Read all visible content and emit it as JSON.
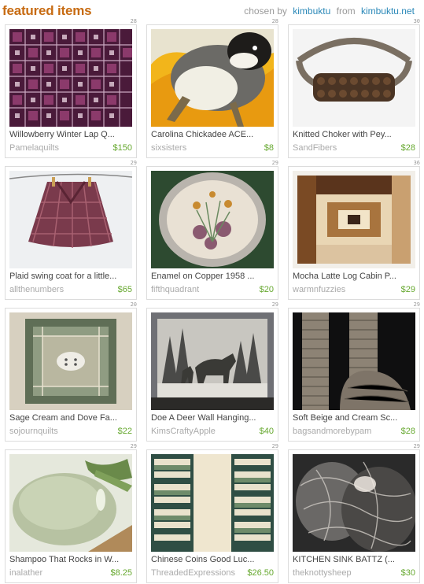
{
  "header": {
    "title": "featured items",
    "chosen_by": "chosen by",
    "curator": "kimbuktu",
    "from": "from",
    "site": "kimbuktu.net"
  },
  "items": [
    {
      "num": "28",
      "name": "Willowberry Winter Lap Q...",
      "shop": "Pamelaquilts",
      "price": "$150"
    },
    {
      "num": "28",
      "name": "Carolina Chickadee  ACE...",
      "shop": "sixsisters",
      "price": "$8"
    },
    {
      "num": "30",
      "name": "Knitted Choker with Pey...",
      "shop": "SandFibers",
      "price": "$28"
    },
    {
      "num": "29",
      "name": "Plaid swing coat for a little...",
      "shop": "allthenumbers",
      "price": "$65"
    },
    {
      "num": "29",
      "name": "Enamel on Copper 1958 ...",
      "shop": "fifthquadrant",
      "price": "$20"
    },
    {
      "num": "36",
      "name": "Mocha Latte Log Cabin P...",
      "shop": "warmnfuzzies",
      "price": "$29"
    },
    {
      "num": "20",
      "name": "Sage Cream and Dove Fa...",
      "shop": "sojournquilts",
      "price": "$22"
    },
    {
      "num": "29",
      "name": "Doe A Deer Wall Hanging...",
      "shop": "KimsCraftyApple",
      "price": "$40"
    },
    {
      "num": "29",
      "name": "Soft Beige and Cream Sc...",
      "shop": "bagsandmorebypam",
      "price": "$28"
    },
    {
      "num": "29",
      "name": "Shampoo That Rocks in W...",
      "shop": "inalather",
      "price": "$8.25"
    },
    {
      "num": "29",
      "name": "Chinese Coins Good Luc...",
      "shop": "ThreadedExpressions",
      "price": "$26.50"
    },
    {
      "num": "29",
      "name": "KITCHEN SINK BATTZ (...",
      "shop": "theknottysheep",
      "price": "$30"
    }
  ]
}
